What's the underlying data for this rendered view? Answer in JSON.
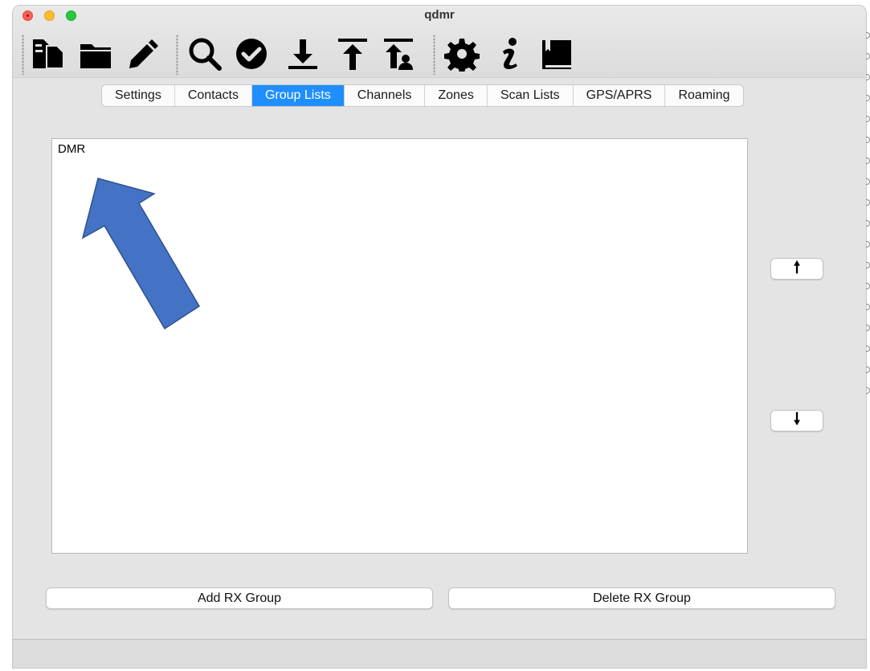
{
  "window": {
    "title": "qdmr"
  },
  "toolbar": {
    "tools": [
      {
        "name": "new-config",
        "icon": "new-document-icon"
      },
      {
        "name": "open-config",
        "icon": "folder-icon"
      },
      {
        "name": "save-config",
        "icon": "pencil-icon"
      },
      {
        "name": "detect-device",
        "icon": "search-icon"
      },
      {
        "name": "verify-config",
        "icon": "check-circle-icon"
      },
      {
        "name": "download-from-device",
        "icon": "download-icon"
      },
      {
        "name": "upload-to-device",
        "icon": "upload-icon"
      },
      {
        "name": "upload-callsign-db",
        "icon": "upload-contacts-icon"
      },
      {
        "name": "settings",
        "icon": "gear-icon"
      },
      {
        "name": "about",
        "icon": "info-icon"
      },
      {
        "name": "help",
        "icon": "book-icon"
      }
    ]
  },
  "tabs": [
    {
      "label": "Settings",
      "active": false
    },
    {
      "label": "Contacts",
      "active": false
    },
    {
      "label": "Group Lists",
      "active": true
    },
    {
      "label": "Channels",
      "active": false
    },
    {
      "label": "Zones",
      "active": false
    },
    {
      "label": "Scan Lists",
      "active": false
    },
    {
      "label": "GPS/APRS",
      "active": false
    },
    {
      "label": "Roaming",
      "active": false
    }
  ],
  "group_list": {
    "items": [
      "DMR"
    ]
  },
  "buttons": {
    "move_up": "🠕",
    "move_down": "🠗",
    "add": "Add RX Group",
    "delete": "Delete RX Group"
  },
  "colors": {
    "active_tab": "#1f8fff",
    "annotation_arrow": "#4472c4",
    "annotation_arrow_border": "#2f528f"
  }
}
